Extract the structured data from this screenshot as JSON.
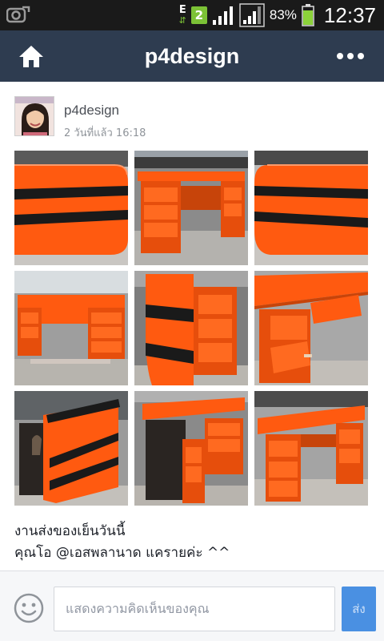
{
  "status_bar": {
    "network": "E",
    "sim_badge": "2",
    "battery_percent": "83%",
    "time": "12:37",
    "battery_level": 0.83
  },
  "nav": {
    "title": "p4design",
    "home_icon": "home-icon",
    "more_icon": "more-icon"
  },
  "post": {
    "author": "p4design",
    "time": "2 วันที่แล้ว 16:18",
    "caption_line1": "งานส่งของเย็นวันนี้",
    "caption_line2": "คุณโอ @เอสพลานาด แคราย​ค่ะ  ^^",
    "photo_count": 9
  },
  "composer": {
    "placeholder": "แสดงความคิดเห็นของคุณ",
    "send_label": "ส่ง"
  },
  "colors": {
    "navbar": "#2e3c50",
    "accent": "#4a90e2",
    "furniture_orange": "#ff5a10"
  }
}
